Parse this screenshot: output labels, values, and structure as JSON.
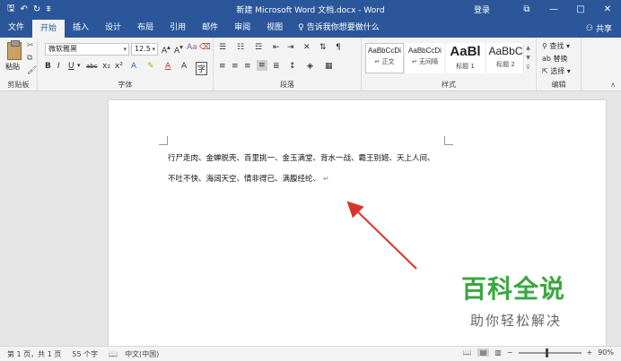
{
  "titlebar": {
    "qat_save": "🖫",
    "qat_undo": "↶",
    "qat_redo": "↻",
    "qat_customize": "⩨",
    "title": "新建 Microsoft Word 文档.docx - Word",
    "login": "登录",
    "ribbon_display": "⧉",
    "minimize": "—",
    "maximize": "□",
    "close": "✕"
  },
  "tabs": [
    "文件",
    "开始",
    "插入",
    "设计",
    "布局",
    "引用",
    "邮件",
    "审阅",
    "视图"
  ],
  "active_tab": "开始",
  "tellme": "告诉我你想要做什么",
  "share": "共享",
  "ribbon": {
    "clipboard": {
      "paste": "粘贴",
      "label": "剪贴板"
    },
    "font": {
      "name": "微软雅黑",
      "size": "12.5",
      "label": "字体"
    },
    "paragraph": {
      "label": "段落"
    },
    "styles": {
      "label": "样式",
      "items": [
        {
          "sample": "AaBbCcDi",
          "name": "↵ 正文"
        },
        {
          "sample": "AaBbCcDi",
          "name": "↵ 无间隔"
        },
        {
          "sample": "AaBl",
          "name": "标题 1"
        },
        {
          "sample": "AaBbC",
          "name": "标题 2"
        }
      ]
    },
    "editing": {
      "find": "查找",
      "replace": "替换",
      "select": "选择",
      "label": "编辑"
    }
  },
  "document": {
    "line1": "行尸走肉、金蝉脱壳、百里挑一、金玉满堂、背水一战、霸王别姬、天上人间、",
    "line2": "不吐不快、海阔天空、情非得已、满腹经纶、"
  },
  "watermark": {
    "title": "百科全说",
    "subtitle": "助你轻松解决"
  },
  "status": {
    "page": "第 1 页，共 1 页",
    "words": "55 个字",
    "language": "中文(中国)",
    "zoom": "90%",
    "zoom_fraction": 0.9
  },
  "colors": {
    "accent": "#2b579a",
    "arrow": "#d9342b",
    "watermark_green": "#3aa640"
  }
}
